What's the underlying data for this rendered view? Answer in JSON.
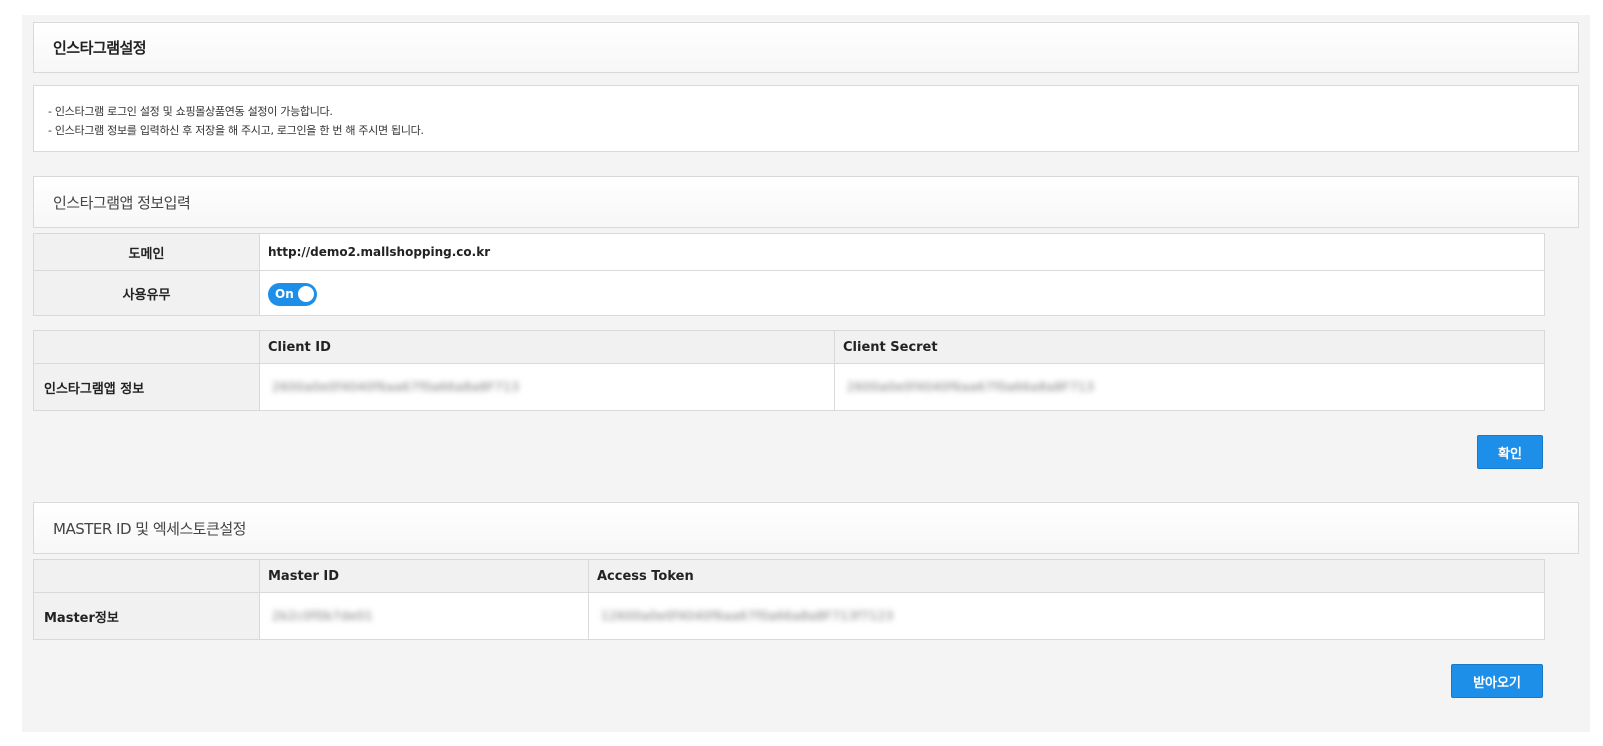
{
  "header": {
    "title": "인스타그램설정"
  },
  "notice": {
    "lines": [
      "- 인스타그램 로그인 설정 및 쇼핑몰상품연동 설정이 가능합니다.",
      "- 인스타그램 정보를 입력하신 후 저장을 해 주시고, 로그인을 한 번 해 주시면 됩니다."
    ]
  },
  "app_section": {
    "title": "인스타그램앱 정보입력",
    "domain_label": "도메인",
    "domain_value": "http://demo2.mallshopping.co.kr",
    "use_label": "사용유무",
    "toggle_label": "On",
    "toggle_state": "on"
  },
  "app_info": {
    "header_client_id": "Client ID",
    "header_client_secret": "Client Secret",
    "row_label": "인스타그램앱 정보",
    "client_id": "2600a0e0f4040f6aa67f0a66a8a8F713",
    "client_secret": "2600a0e0f4040f6aa67f0a66a8a8F713"
  },
  "confirm_button": "확인",
  "master_section": {
    "title": "MASTER ID 및 엑세스토큰설정",
    "header_master_id": "Master ID",
    "header_access_token": "Access Token",
    "row_label": "Master정보",
    "master_id": "2b2c0f0b7de01",
    "access_token": "12600a0e0f4040f6aa67f0a66a8a8F713f7123"
  },
  "fetch_button": "받아오기",
  "colors": {
    "accent": "#1e8fe8",
    "background": "#f4f4f4",
    "border": "#d9d9d9"
  }
}
